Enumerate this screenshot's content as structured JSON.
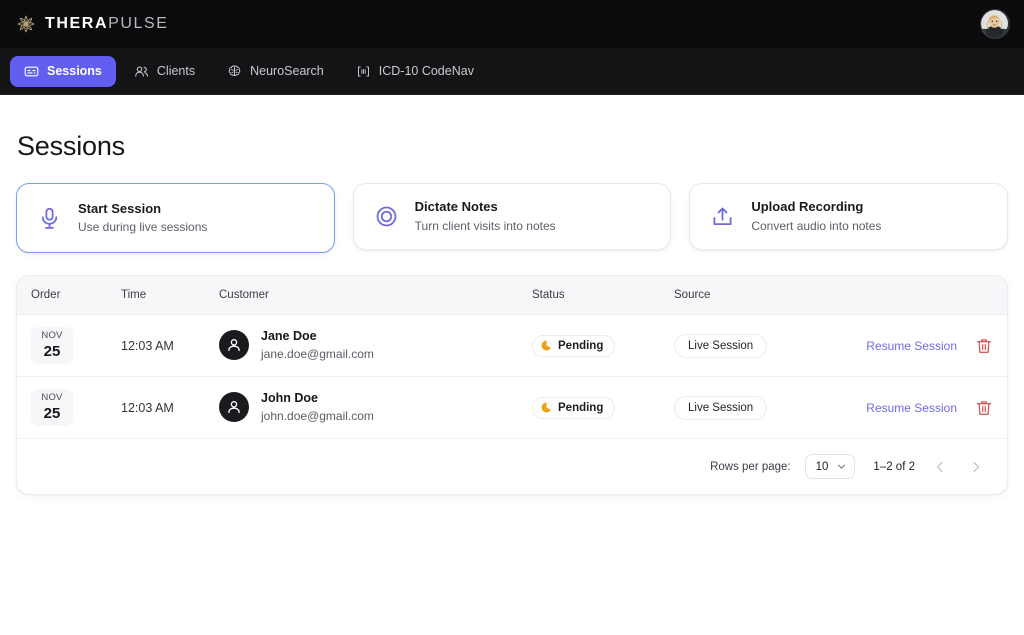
{
  "brand": {
    "part1": "THERA",
    "part2": "PULSE",
    "logo_icon": "mandala-flower-icon",
    "accent": "#b9a77a"
  },
  "topbar": {
    "avatar_icon": "user-photo-avatar"
  },
  "nav": {
    "items": [
      {
        "label": "Sessions",
        "icon": "closed-captions-icon",
        "active": true
      },
      {
        "label": "Clients",
        "icon": "users-icon",
        "active": false
      },
      {
        "label": "NeuroSearch",
        "icon": "brain-icon",
        "active": false
      },
      {
        "label": "ICD-10 CodeNav",
        "icon": "barcode-brackets-icon",
        "active": false
      }
    ],
    "active_color": "#615ef0"
  },
  "page": {
    "title": "Sessions"
  },
  "cards": [
    {
      "title": "Start Session",
      "subtitle": "Use during live sessions",
      "icon": "microphone-icon",
      "selected": true
    },
    {
      "title": "Dictate Notes",
      "subtitle": "Turn client visits into notes",
      "icon": "record-circle-icon",
      "selected": false
    },
    {
      "title": "Upload Recording",
      "subtitle": "Convert audio into notes",
      "icon": "upload-tray-icon",
      "selected": false
    }
  ],
  "table": {
    "columns": [
      "Order",
      "Time",
      "Customer",
      "Status",
      "Source",
      ""
    ],
    "rows": [
      {
        "month": "NOV",
        "day": "25",
        "time": "12:03 AM",
        "name": "Jane Doe",
        "email": "jane.doe@gmail.com",
        "status": "Pending",
        "source": "Live Session",
        "action": "Resume Session",
        "delete_icon": "trash-icon"
      },
      {
        "month": "NOV",
        "day": "25",
        "time": "12:03 AM",
        "name": "John Doe",
        "email": "john.doe@gmail.com",
        "status": "Pending",
        "source": "Live Session",
        "action": "Resume Session",
        "delete_icon": "trash-icon"
      }
    ],
    "status_color": "#e8a317",
    "link_color": "#6f6ae8",
    "delete_color": "#d45f5f"
  },
  "pagination": {
    "rows_label": "Rows per page:",
    "rows_value": "10",
    "range": "1–2 of 2",
    "prev_icon": "chevron-left-icon",
    "next_icon": "chevron-right-icon"
  }
}
